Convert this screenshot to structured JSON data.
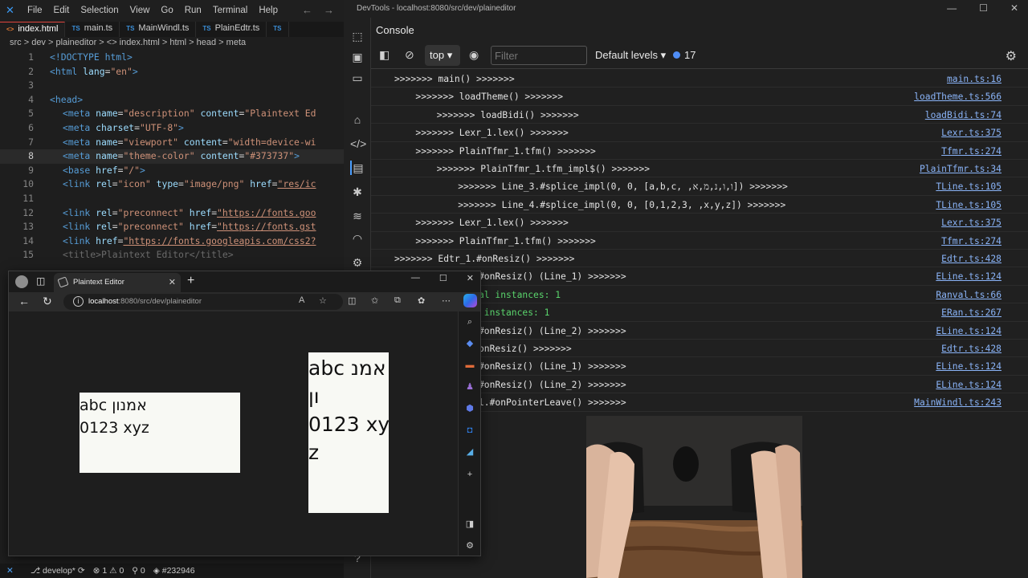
{
  "vscode": {
    "menu": [
      "File",
      "Edit",
      "Selection",
      "View",
      "Go",
      "Run",
      "Terminal",
      "Help"
    ],
    "tabs": [
      {
        "icon": "<>",
        "label": "index.html",
        "active": true
      },
      {
        "icon": "TS",
        "label": "main.ts",
        "active": false
      },
      {
        "icon": "TS",
        "label": "MainWindl.ts",
        "active": false
      },
      {
        "icon": "TS",
        "label": "PlainEdtr.ts",
        "active": false
      },
      {
        "icon": "TS",
        "label": "",
        "active": false
      }
    ],
    "breadcrumb": "src  >  dev  >  plaineditor  >  <>  index.html  >  html  >  head  >  meta",
    "lines": [
      "1",
      "2",
      "3",
      "4",
      "5",
      "6",
      "7",
      "8",
      "9",
      "10",
      "11",
      "12",
      "13",
      "14",
      "15"
    ],
    "code": {
      "l1": "<!DOCTYPE html>",
      "l2a": "<html",
      "l2b": " lang",
      "l2c": "=",
      "l2d": "\"en\"",
      "l2e": ">",
      "l4": "<head>",
      "l5a": "<meta",
      "l5b": " name",
      "l5c": "=",
      "l5d": "\"description\"",
      "l5e": " content",
      "l5f": "=",
      "l5g": "\"Plaintext Ed",
      "l6a": "<meta",
      "l6b": " charset",
      "l6c": "=",
      "l6d": "\"UTF-8\"",
      "l6e": ">",
      "l7a": "<meta",
      "l7b": " name",
      "l7c": "=",
      "l7d": "\"viewport\"",
      "l7e": " content",
      "l7f": "=",
      "l7g": "\"width=device-wi",
      "l8a": "<meta",
      "l8b": " name",
      "l8c": "=",
      "l8d": "\"theme-color\"",
      "l8e": " content",
      "l8f": "=",
      "l8g": "\"#373737\"",
      "l8h": ">",
      "l9a": "<base",
      "l9b": " href",
      "l9c": "=",
      "l9d": "\"/\"",
      "l9e": ">",
      "l10a": "<link",
      "l10b": " rel",
      "l10c": "=",
      "l10d": "\"icon\"",
      "l10e": " type",
      "l10f": "=",
      "l10g": "\"image/png\"",
      "l10h": " href",
      "l10i": "=",
      "l10j": "\"res/ic",
      "l12a": "<link",
      "l12b": " rel",
      "l12c": "=",
      "l12d": "\"preconnect\"",
      "l12e": " href",
      "l12f": "=",
      "l12g": "\"https://fonts.goo",
      "l13a": "<link",
      "l13b": " rel",
      "l13c": "=",
      "l13d": "\"preconnect\"",
      "l13e": " href",
      "l13f": "=",
      "l13g": "\"https://fonts.gst",
      "l14a": "<link",
      "l14b": " href",
      "l14c": "=",
      "l14d": "\"https://fonts.googleapis.com/css2?",
      "l15": "<title>Plaintext Editor</title>"
    },
    "status": {
      "branch": "develop*",
      "errors": "1",
      "warnings": "0",
      "ports": "0",
      "commit": "#232946"
    }
  },
  "devtools": {
    "window_title": "DevTools - localhost:8080/src/dev/plaineditor",
    "panel": "Console",
    "context": "top",
    "filter_placeholder": "Filter",
    "levels": "Default levels",
    "issues_count": "17",
    "messages": [
      {
        "text": ">>>>>>> main() >>>>>>>",
        "source": "main.ts:16",
        "indent": 0,
        "color": "normal"
      },
      {
        "text": ">>>>>>> loadTheme() >>>>>>>",
        "source": "loadTheme.ts:566",
        "indent": 1,
        "color": "normal"
      },
      {
        "text": ">>>>>>> loadBidi() >>>>>>>",
        "source": "loadBidi.ts:74",
        "indent": 2,
        "color": "normal"
      },
      {
        "text": ">>>>>>> Lexr_1.lex() >>>>>>>",
        "source": "Lexr.ts:375",
        "indent": 1,
        "color": "normal"
      },
      {
        "text": ">>>>>>> PlainTfmr_1.tfm() >>>>>>>",
        "source": "Tfmr.ts:274",
        "indent": 1,
        "color": "normal"
      },
      {
        "text": ">>>>>>> PlainTfmr_1.tfm_impl$() >>>>>>>",
        "source": "PlainTfmr.ts:34",
        "indent": 2,
        "color": "normal"
      },
      {
        "text": ">>>>>>> Line_3.#splice_impl(0, 0, [a,b,c, ,ו,ו,נ,מ,א]) >>>>>>>",
        "source": "TLine.ts:105",
        "indent": 3,
        "color": "normal"
      },
      {
        "text": ">>>>>>> Line_4.#splice_impl(0, 0, [0,1,2,3, ,x,y,z]) >>>>>>>",
        "source": "TLine.ts:105",
        "indent": 3,
        "color": "normal"
      },
      {
        "text": ">>>>>>> Lexr_1.lex() >>>>>>>",
        "source": "Lexr.ts:375",
        "indent": 1,
        "color": "normal"
      },
      {
        "text": ">>>>>>> PlainTfmr_1.tfm() >>>>>>>",
        "source": "Tfmr.ts:274",
        "indent": 1,
        "color": "normal"
      },
      {
        "text": ">>>>>>> Edtr_1.#onResiz() >>>>>>>",
        "source": "Edtr.ts:428",
        "indent": 0,
        "color": "normal"
      },
      {
        "text": "#onResiz() (Line_1) >>>>>>>",
        "source": "ELine.ts:124",
        "indent": 4,
        "color": "normal"
      },
      {
        "text": "al instances: 1",
        "source": "Ranval.ts:66",
        "indent": 4,
        "color": "green"
      },
      {
        "text": " instances: 1",
        "source": "ERan.ts:267",
        "indent": 4,
        "color": "green"
      },
      {
        "text": "#onResiz() (Line_2) >>>>>>>",
        "source": "ELine.ts:124",
        "indent": 4,
        "color": "normal"
      },
      {
        "text": "onResiz() >>>>>>>",
        "source": "Edtr.ts:428",
        "indent": 4,
        "color": "normal"
      },
      {
        "text": "#onResiz() (Line_1) >>>>>>>",
        "source": "ELine.ts:124",
        "indent": 4,
        "color": "normal"
      },
      {
        "text": "#onResiz() (Line_2) >>>>>>>",
        "source": "ELine.ts:124",
        "indent": 4,
        "color": "normal"
      },
      {
        "text": "l.#onPointerLeave() >>>>>>>",
        "source": "MainWindl.ts:243",
        "indent": 4,
        "color": "normal"
      }
    ]
  },
  "browser": {
    "tab_title": "Plaintext Editor",
    "url_host": "localhost",
    "url_path": ":8080/src/dev/plaineditor",
    "pane_a": [
      "abc אמנון",
      "0123 xyz"
    ],
    "pane_b": [
      "abc אמנ",
      "ון",
      "0123 xy",
      "z"
    ]
  },
  "colors": {
    "accent": "#3b9bf5",
    "console_link": "#8ab4f8",
    "console_green": "#5ad46c",
    "page_bg": "#f8f9f4"
  }
}
